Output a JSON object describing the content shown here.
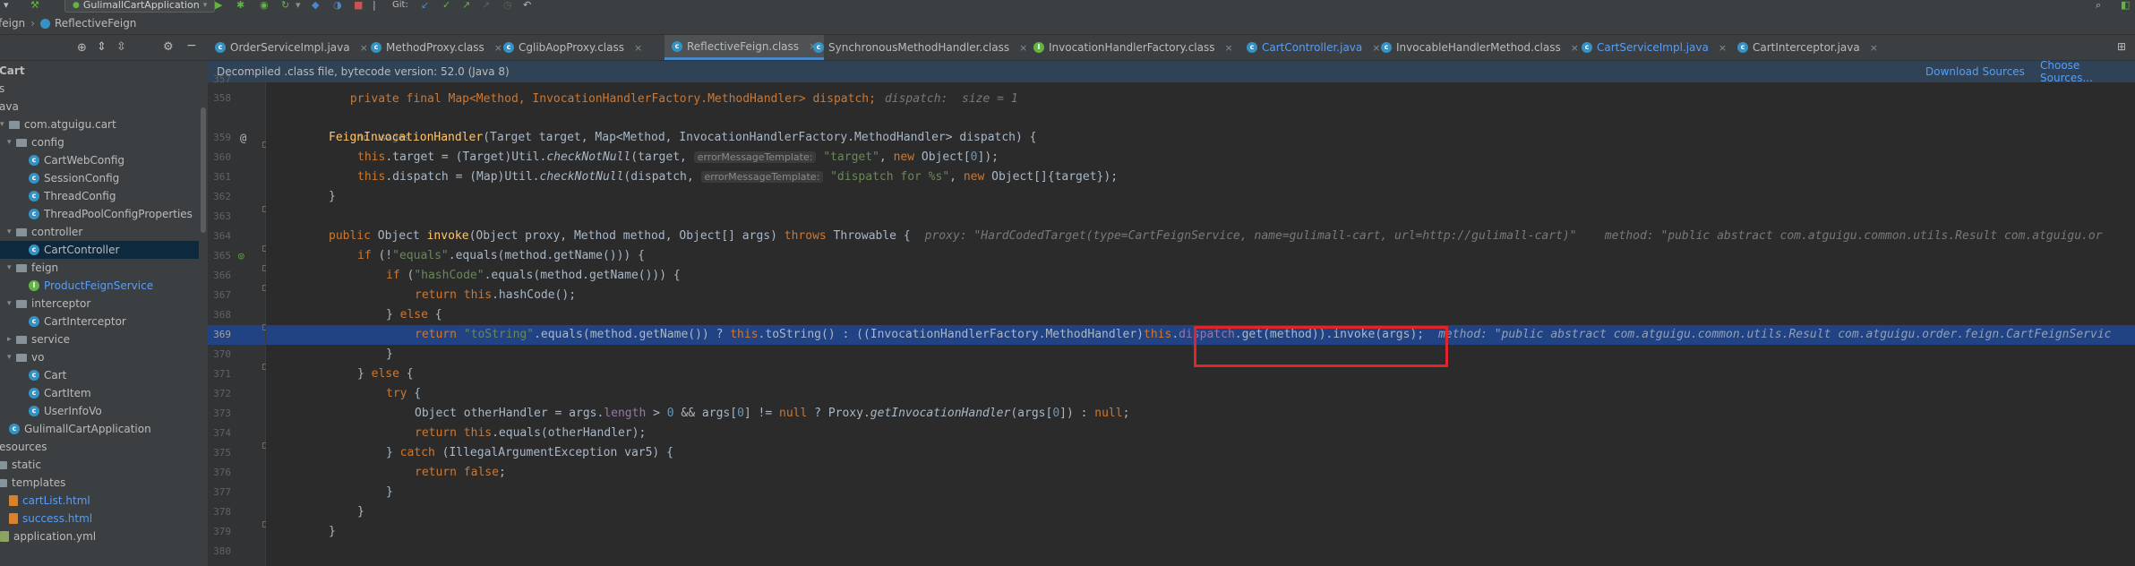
{
  "toolbar": {
    "run_config": "GulimallCartApplication",
    "git_label": "Git:"
  },
  "breadcrumb": [
    "feign",
    "ReflectiveFeign"
  ],
  "project": {
    "title": "Cart",
    "tree": [
      {
        "label": "s",
        "depth": 0,
        "kind": "text"
      },
      {
        "label": "ava",
        "depth": 0,
        "kind": "src"
      },
      {
        "label": "com.atguigu.cart",
        "depth": 0,
        "kind": "pkg",
        "expanded": true
      },
      {
        "label": "config",
        "depth": 1,
        "kind": "pkg",
        "expanded": true
      },
      {
        "label": "CartWebConfig",
        "depth": 2,
        "kind": "class"
      },
      {
        "label": "SessionConfig",
        "depth": 2,
        "kind": "class"
      },
      {
        "label": "ThreadConfig",
        "depth": 2,
        "kind": "class"
      },
      {
        "label": "ThreadPoolConfigProperties",
        "depth": 2,
        "kind": "class"
      },
      {
        "label": "controller",
        "depth": 1,
        "kind": "pkg",
        "expanded": true
      },
      {
        "label": "CartController",
        "depth": 2,
        "kind": "class",
        "selected": true
      },
      {
        "label": "feign",
        "depth": 1,
        "kind": "pkg",
        "expanded": true
      },
      {
        "label": "ProductFeignService",
        "depth": 2,
        "kind": "interface",
        "blue": true
      },
      {
        "label": "interceptor",
        "depth": 1,
        "kind": "pkg",
        "expanded": true
      },
      {
        "label": "CartInterceptor",
        "depth": 2,
        "kind": "class"
      },
      {
        "label": "service",
        "depth": 1,
        "kind": "pkg",
        "expanded": false
      },
      {
        "label": "vo",
        "depth": 1,
        "kind": "pkg",
        "expanded": true
      },
      {
        "label": "Cart",
        "depth": 2,
        "kind": "class"
      },
      {
        "label": "CartItem",
        "depth": 2,
        "kind": "class"
      },
      {
        "label": "UserInfoVo",
        "depth": 2,
        "kind": "class"
      },
      {
        "label": "GulimallCartApplication",
        "depth": 1,
        "kind": "app"
      },
      {
        "label": "esources",
        "depth": 0,
        "kind": "res"
      },
      {
        "label": "static",
        "depth": 0,
        "kind": "folder"
      },
      {
        "label": "templates",
        "depth": 0,
        "kind": "folder",
        "expanded": true
      },
      {
        "label": "cartList.html",
        "depth": 1,
        "kind": "html",
        "blue": true
      },
      {
        "label": "success.html",
        "depth": 1,
        "kind": "html",
        "blue": true
      },
      {
        "label": "application.yml",
        "depth": 0,
        "kind": "yml"
      }
    ]
  },
  "tabs": [
    {
      "label": "OrderServiceImpl.java",
      "kind": "class"
    },
    {
      "label": "MethodProxy.class",
      "kind": "class"
    },
    {
      "label": "CglibAopProxy.class",
      "kind": "class"
    },
    {
      "label": "ReflectiveFeign.class",
      "kind": "class",
      "active": true
    },
    {
      "label": "SynchronousMethodHandler.class",
      "kind": "class"
    },
    {
      "label": "InvocationHandlerFactory.class",
      "kind": "interface"
    },
    {
      "label": "CartController.java",
      "kind": "class",
      "blue": true
    },
    {
      "label": "InvocableHandlerMethod.class",
      "kind": "class"
    },
    {
      "label": "CartServiceImpl.java",
      "kind": "class",
      "blue": true
    },
    {
      "label": "CartInterceptor.java",
      "kind": "class"
    }
  ],
  "notice": {
    "text": "Decompiled .class file, bytecode version: 52.0 (Java 8)",
    "download": "Download Sources",
    "choose": "Choose Sources..."
  },
  "editor": {
    "line_numbers": [
      "357",
      "358",
      "",
      "359",
      "360",
      "361",
      "362",
      "363",
      "364",
      "365",
      "366",
      "367",
      "368",
      "369",
      "370",
      "371",
      "372",
      "373",
      "374",
      "375",
      "376",
      "377",
      "378",
      "379",
      "380"
    ],
    "highlighted_line": "369",
    "texts": {
      "l357": "        private final Map<Method, InvocationHandlerFactory.MethodHandler> dispatch;",
      "l357_hint": "dispatch:  size = 1",
      "no_usages": "no usages",
      "l359_a": "FeignInvocationHandler",
      "l359_b": "(Target target, Map<Method, InvocationHandlerFactory.MethodHandler> dispatch) {",
      "l360_a": "this",
      "l360_b": ".target = (Target)Util.",
      "l360_c": "checkNotNull",
      "l360_d": "(target,",
      "l360_chip": "errorMessageTemplate:",
      "l360_e": "\"target\"",
      "l360_f": ", ",
      "l360_g": "new",
      "l360_h": " Object[",
      "l360_i": "0",
      "l360_j": "]);",
      "l361_a": "this",
      "l361_b": ".dispatch = (Map)Util.",
      "l361_c": "checkNotNull",
      "l361_d": "(dispatch,",
      "l361_chip": "errorMessageTemplate:",
      "l361_e": "\"dispatch for %s\"",
      "l361_f": ", ",
      "l361_g": "new",
      "l361_h": " Object[]{target});",
      "l362": "}",
      "l364_a": "public",
      "l364_b": " Object ",
      "l364_c": "invoke",
      "l364_d": "(Object proxy, Method method, Object[] args) ",
      "l364_e": "throws",
      "l364_f": " Throwable {",
      "l364_hint": "proxy: \"HardCodedTarget(type=CartFeignService, name=gulimall-cart, url=http://gulimall-cart)\"    method: \"public abstract com.atguigu.common.utils.Result com.atguigu.or",
      "l365_a": "if",
      "l365_b": " (!",
      "l365_c": "\"equals\"",
      "l365_d": ".equals(method.getName())) {",
      "l366_a": "if",
      "l366_b": " (",
      "l366_c": "\"hashCode\"",
      "l366_d": ".equals(method.getName())) {",
      "l367_a": "return",
      "l367_b": " ",
      "l367_c": "this",
      "l367_d": ".hashCode();",
      "l368_a": "} ",
      "l368_b": "else",
      "l368_c": " {",
      "l369_a": "return",
      "l369_b": " ",
      "l369_c": "\"toString\"",
      "l369_d": ".equals(method.getName()) ? ",
      "l369_e": "this",
      "l369_f": ".toString() : ((InvocationHandlerFactory.MethodHandler)",
      "l369_g": "this",
      "l369_h": ".",
      "l369_i": "dispatch",
      "l369_j": ".get(method)).invoke(args);",
      "l369_hint": "method: \"public abstract com.atguigu.common.utils.Result com.atguigu.order.feign.CartFeignServic",
      "l370": "}",
      "l371_a": "} ",
      "l371_b": "else",
      "l371_c": " {",
      "l372_a": "try",
      "l372_b": " {",
      "l373_a": "Object otherHandler = args.",
      "l373_b": "length",
      "l373_c": " > ",
      "l373_d": "0",
      "l373_e": " && args[",
      "l373_f": "0",
      "l373_g": "] != ",
      "l373_h": "null",
      "l373_i": " ? Proxy.",
      "l373_j": "getInvocationHandler",
      "l373_k": "(args[",
      "l373_l": "0",
      "l373_m": "]) : ",
      "l373_n": "null",
      "l373_o": ";",
      "l374_a": "return",
      "l374_b": " ",
      "l374_c": "this",
      "l374_d": ".equals(otherHandler);",
      "l375_a": "} ",
      "l375_b": "catch",
      "l375_c": " (IllegalArgumentException var5) {",
      "l376_a": "return",
      "l376_b": " ",
      "l376_c": "false",
      "l376_d": ";",
      "l377": "}",
      "l378": "}",
      "l379": "}"
    }
  },
  "colors": {
    "accent": "#4a88c7",
    "highlight_line": "#214283",
    "annotation_box": "#e0242c"
  }
}
